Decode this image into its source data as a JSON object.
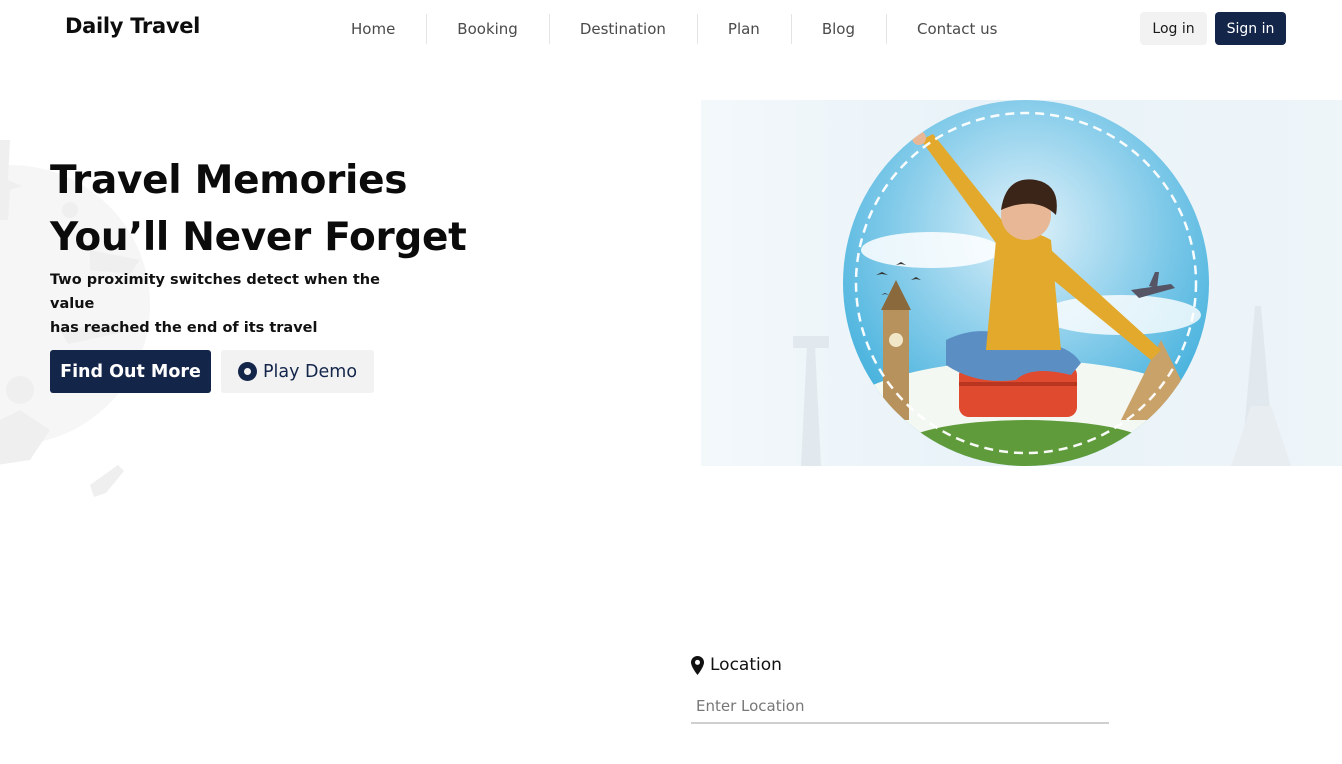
{
  "header": {
    "logo": "Daily Travel",
    "nav": [
      "Home",
      "Booking",
      "Destination",
      "Plan",
      "Blog",
      "Contact us"
    ],
    "login_label": "Log in",
    "signin_label": "Sign in"
  },
  "hero": {
    "title_line1": "Travel Memories",
    "title_line2": "You’ll Never Forget",
    "subtitle_line1": "Two proximity switches detect when the value",
    "subtitle_line2": "has reached the end of its travel",
    "primary_button": "Find Out More",
    "secondary_button": "Play Demo"
  },
  "search": {
    "location_label": "Location",
    "location_placeholder": "Enter Location"
  },
  "colors": {
    "brand_navy": "#14254a",
    "light_button": "#f2f2f2",
    "sky_blue": "#2fa8d8"
  },
  "icons": {
    "play": "play-circle-icon",
    "location": "map-pin-icon"
  }
}
